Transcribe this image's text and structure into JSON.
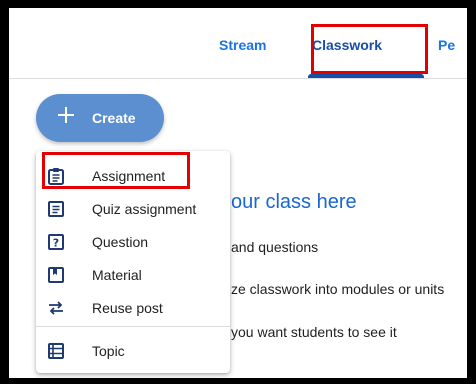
{
  "nav": {
    "tabs": [
      {
        "label": "Stream"
      },
      {
        "label": "Classwork"
      },
      {
        "label": "Pe"
      }
    ]
  },
  "create_button": {
    "label": "Create",
    "icon": "plus-icon"
  },
  "menu": {
    "items": [
      {
        "label": "Assignment",
        "icon": "assignment-icon"
      },
      {
        "label": "Quiz assignment",
        "icon": "quiz-icon"
      },
      {
        "label": "Question",
        "icon": "question-icon"
      },
      {
        "label": "Material",
        "icon": "material-icon"
      },
      {
        "label": "Reuse post",
        "icon": "reuse-icon"
      },
      {
        "label": "Topic",
        "icon": "topic-icon"
      }
    ]
  },
  "empty_state": {
    "title": "our class here",
    "line1": "and questions",
    "line2": "ze classwork into modules or units",
    "line3": "you want students to see it"
  },
  "colors": {
    "accent": "#1a73e8",
    "create_bg": "#5b8fcf",
    "highlight": "#e30000"
  }
}
